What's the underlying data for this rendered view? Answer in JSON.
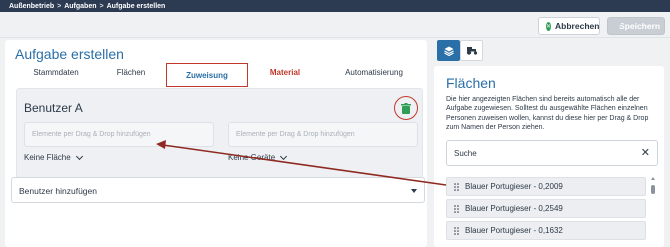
{
  "breadcrumb": {
    "items": [
      "Außenbetrieb",
      "Aufgaben",
      "Aufgabe erstellen"
    ],
    "separator": ">"
  },
  "actions": {
    "cancel_label": "Abbrechen",
    "save_label": "Speichern"
  },
  "main": {
    "title": "Aufgabe erstellen",
    "tabs": [
      {
        "label": "Stammdaten"
      },
      {
        "label": "Flächen"
      },
      {
        "label": "Zuweisung"
      },
      {
        "label": "Material"
      },
      {
        "label": "Automatisierung"
      }
    ],
    "active_tab": "Zuweisung",
    "user_card": {
      "name": "Benutzer A",
      "drop_placeholder_left": "Elemente per Drag & Drop hinzufügen",
      "drop_placeholder_right": "Elemente per Drag & Drop hinzufügen",
      "area_selector": "Keine Fläche",
      "device_selector": "Keine Geräte"
    },
    "add_user_placeholder": "Benutzer hinzufügen"
  },
  "right_panel": {
    "title": "Flächen",
    "description": "Die hier angezeigten Flächen sind bereits automatisch alle der Aufgabe zugewiesen. Solltest du ausgewählte Flächen einzelnen Personen zuweisen wollen, kannst du diese hier per Drag & Drop zum Namen der Person ziehen.",
    "search_placeholder": "Suche",
    "items": [
      "Blauer Portugieser - 0,2009",
      "Blauer Portugieser - 0,2549",
      "Blauer Portugieser - 0,1632"
    ]
  },
  "colors": {
    "accent": "#2a6fa8",
    "highlight": "#c0392b",
    "topbar": "#2c3a52",
    "success": "#2e9e55"
  }
}
